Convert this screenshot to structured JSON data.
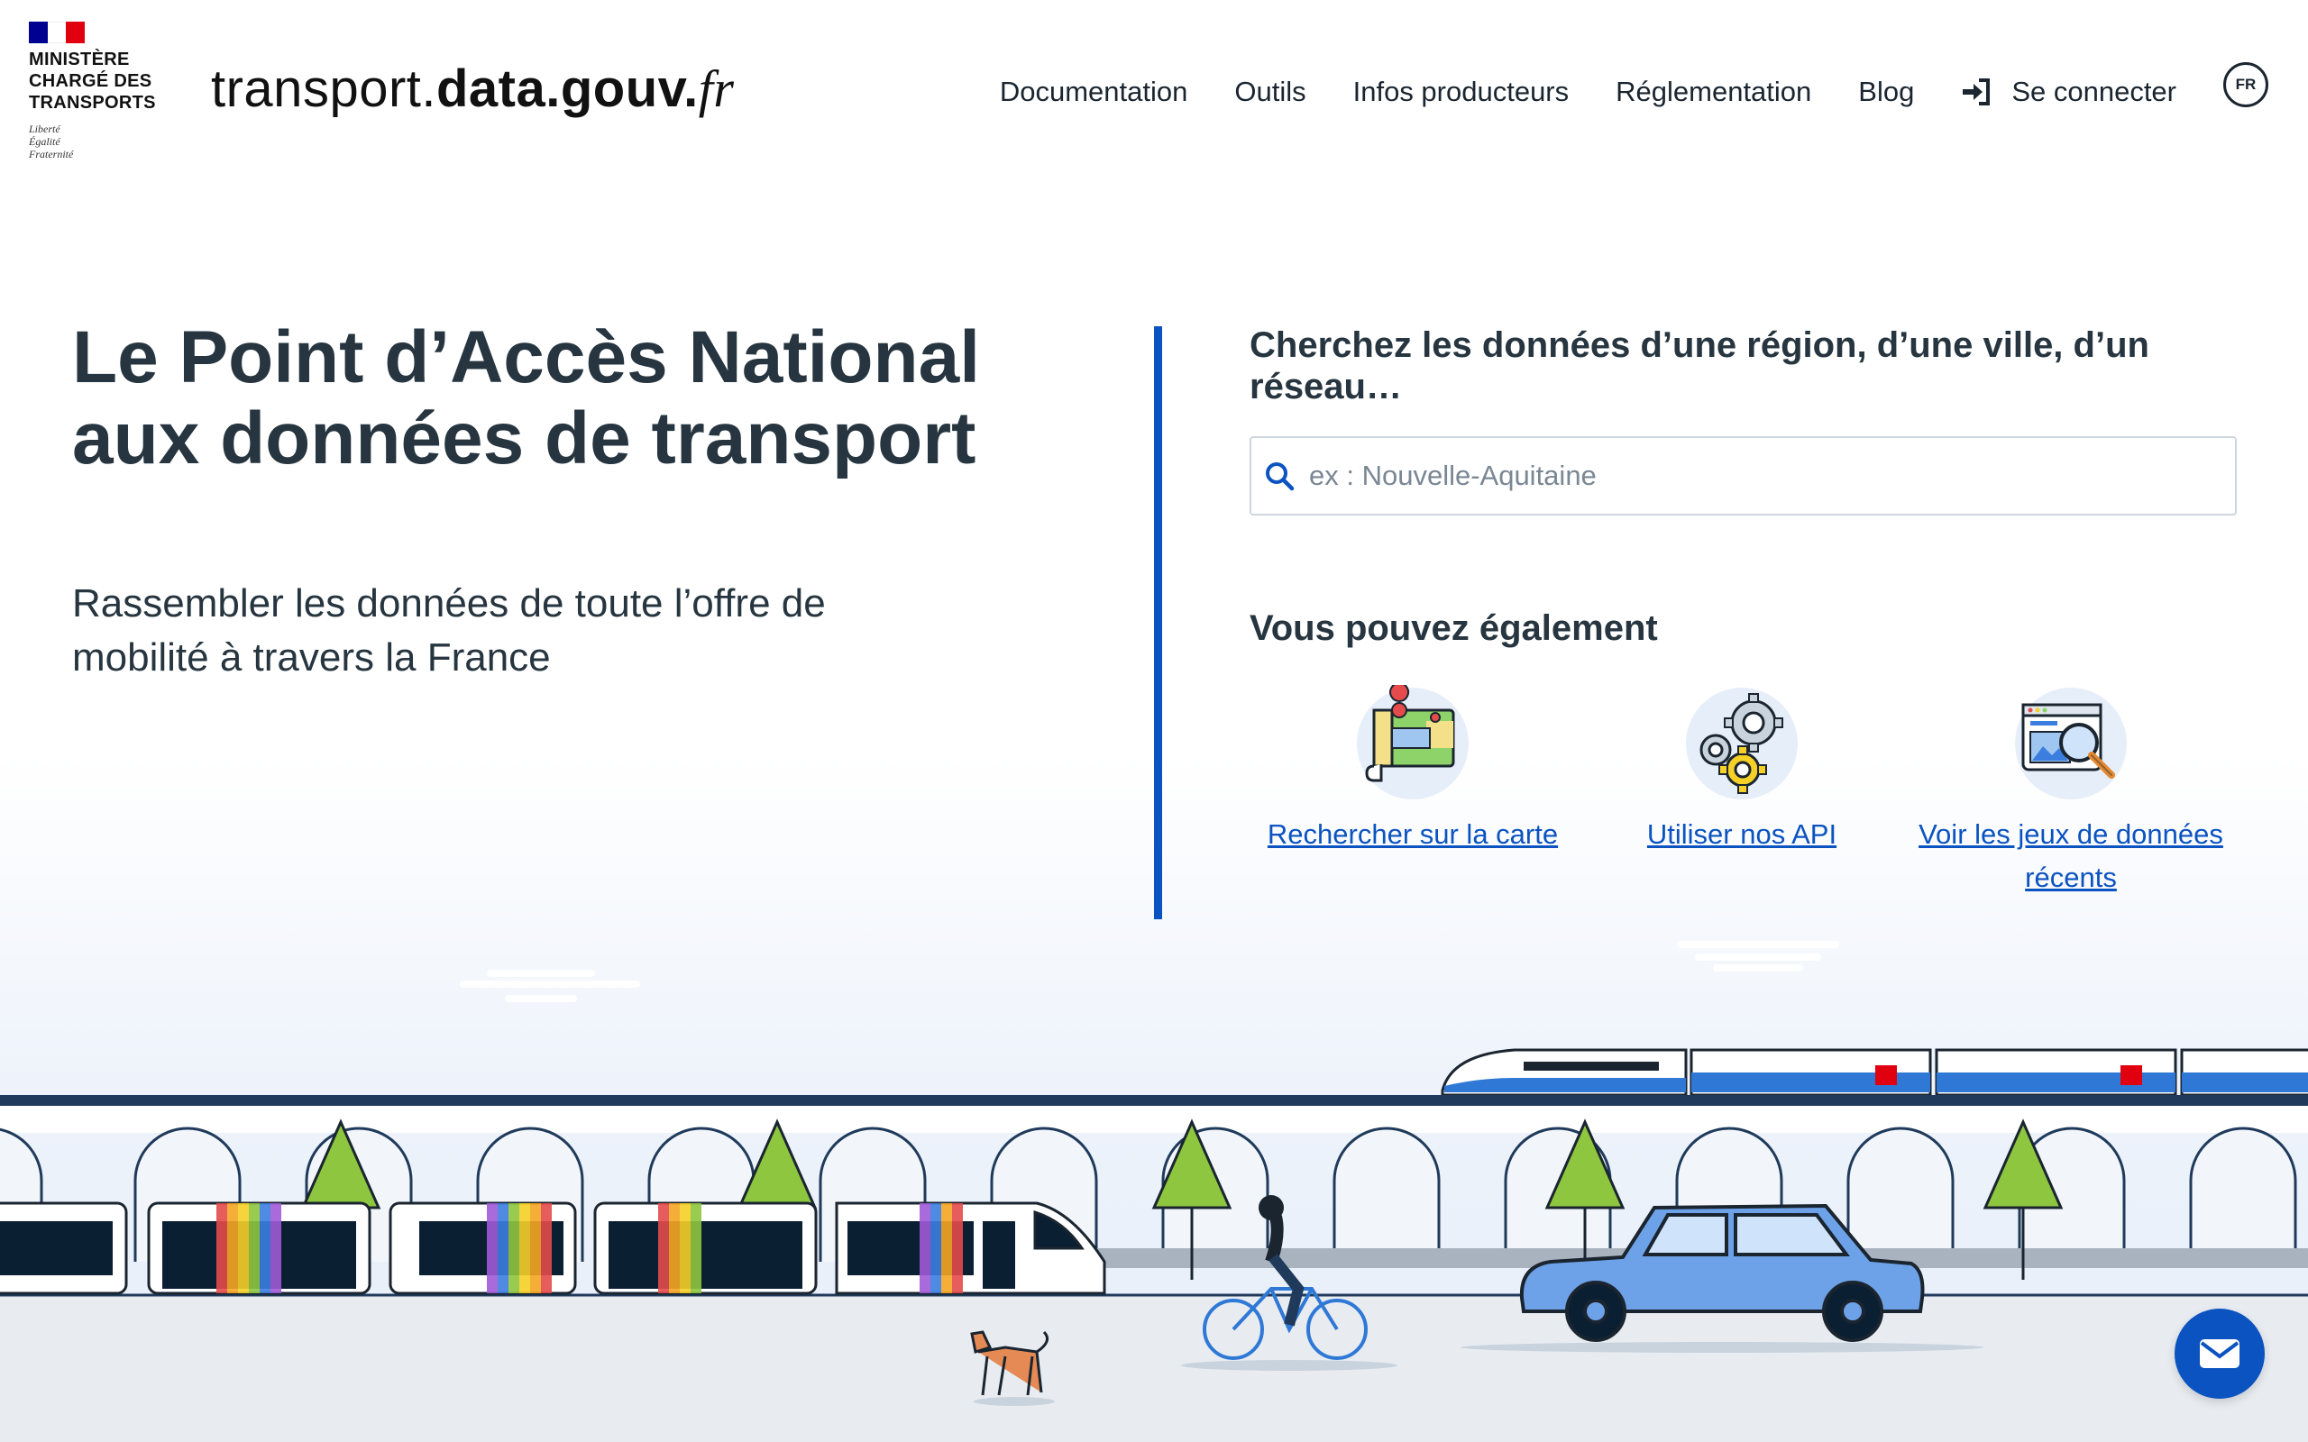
{
  "header": {
    "ministry_lines": [
      "Ministère",
      "chargé des",
      "transports"
    ],
    "motto": [
      "Liberté",
      "Égalité",
      "Fraternité"
    ],
    "site_logo": {
      "part1": "transport.",
      "part2": "data.gouv.",
      "part3": "fr"
    },
    "nav": [
      {
        "label": "Documentation"
      },
      {
        "label": "Outils"
      },
      {
        "label": "Infos producteurs"
      },
      {
        "label": "Réglementation"
      },
      {
        "label": "Blog"
      }
    ],
    "login_label": "Se connecter",
    "language": "FR"
  },
  "hero": {
    "title": "Le Point d’Accès National aux données de transport",
    "subtitle": "Rassembler les données de toute l’offre de mobilité à travers la France"
  },
  "search": {
    "heading": "Cherchez les données d’une région, d’une ville, d’un réseau…",
    "placeholder": "ex : Nouvelle-Aquitaine",
    "value": ""
  },
  "also": {
    "heading": "Vous pouvez également",
    "actions": [
      {
        "label": "Rechercher sur la carte",
        "icon": "map-icon"
      },
      {
        "label": "Utiliser nos API",
        "icon": "gears-icon"
      },
      {
        "label": "Voir les jeux de données récents",
        "icon": "dataset-search-icon"
      }
    ]
  },
  "colors": {
    "accent": "#0b53c1",
    "text": "#26353f",
    "flag_blue": "#000091",
    "flag_red": "#e1000f"
  }
}
